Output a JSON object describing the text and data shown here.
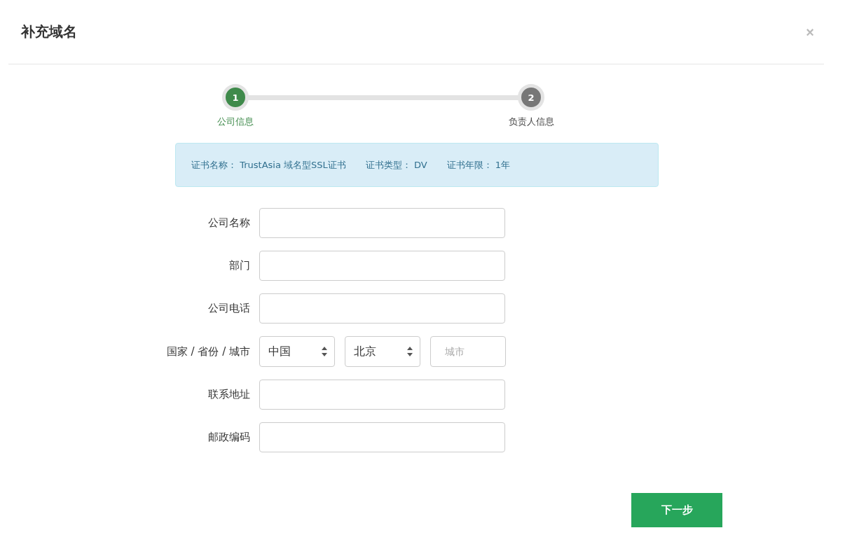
{
  "dialog": {
    "title": "补充域名",
    "close": "×"
  },
  "steps": [
    {
      "number": "1",
      "label": "公司信息",
      "active": true
    },
    {
      "number": "2",
      "label": "负责人信息",
      "active": false
    }
  ],
  "info": [
    {
      "label": "证书名称：",
      "value": "TrustAsia 域名型SSL证书"
    },
    {
      "label": "证书类型：",
      "value": "DV"
    },
    {
      "label": "证书年限：",
      "value": "1年"
    }
  ],
  "form": [
    {
      "kind": "text",
      "label": "公司名称"
    },
    {
      "kind": "text",
      "label": "部门"
    },
    {
      "kind": "text",
      "label": "公司电话"
    },
    {
      "kind": "location",
      "label": "国家 / 省份 / 城市",
      "country": "中国",
      "province": "北京",
      "city_placeholder": "城市"
    },
    {
      "kind": "text",
      "label": "联系地址"
    },
    {
      "kind": "text",
      "label": "邮政编码"
    }
  ],
  "next_button": "下一步"
}
